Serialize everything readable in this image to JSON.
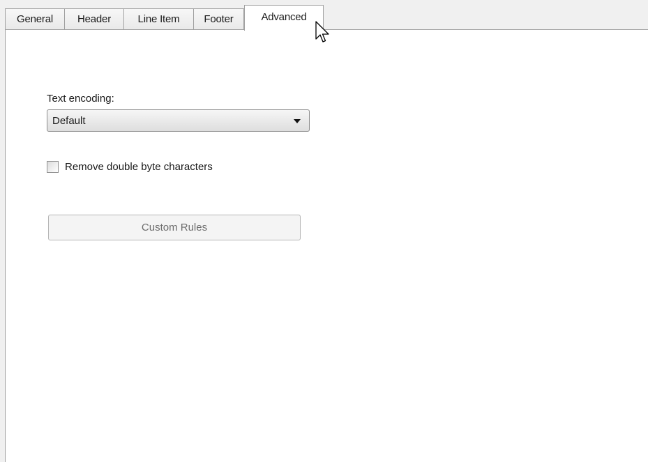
{
  "tabs": [
    {
      "label": "General"
    },
    {
      "label": "Header"
    },
    {
      "label": "Line Item"
    },
    {
      "label": "Footer"
    },
    {
      "label": "Advanced",
      "active": true
    }
  ],
  "advanced": {
    "encoding_label": "Text encoding:",
    "encoding_value": "Default",
    "remove_double_byte_label": "Remove double byte characters",
    "remove_double_byte_checked": false,
    "custom_rules_label": "Custom Rules",
    "custom_rules_enabled": false
  },
  "icons": {
    "cursor": "mouse-pointer-icon",
    "dropdown": "dropdown-arrow-icon"
  }
}
